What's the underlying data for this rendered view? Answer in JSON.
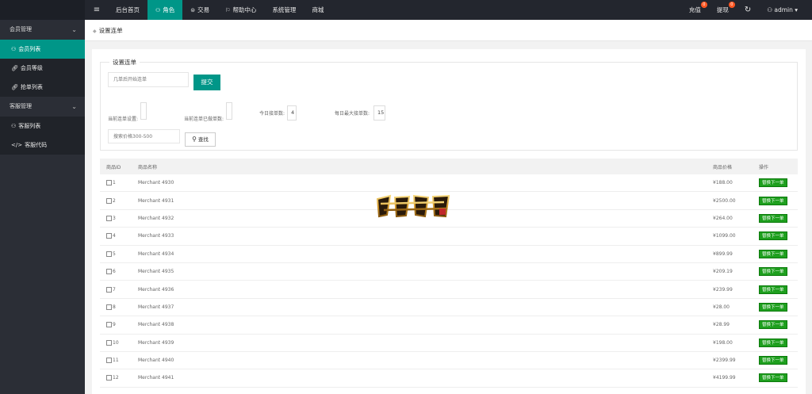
{
  "topbar": {
    "menu_toggle": "≡",
    "nav": [
      {
        "label": "后台首页",
        "icon": "",
        "active": false
      },
      {
        "label": "角色",
        "icon": "user-icon",
        "active": true
      },
      {
        "label": "交易",
        "icon": "globe-icon",
        "active": false
      },
      {
        "label": "帮助中心",
        "icon": "flag-icon",
        "active": false
      },
      {
        "label": "系统管理",
        "icon": "",
        "active": false
      },
      {
        "label": "商城",
        "icon": "",
        "active": false
      }
    ],
    "right": [
      {
        "label": "充值",
        "badge": "0"
      },
      {
        "label": "提现",
        "badge": "0"
      },
      {
        "label": "↻"
      },
      {
        "label": "admin"
      }
    ]
  },
  "sidebar": {
    "groups": [
      {
        "label": "会员管理",
        "items": [
          {
            "label": "会员列表",
            "icon": "user-icon",
            "active": true
          },
          {
            "label": "会员等级",
            "icon": "link-icon",
            "active": false
          },
          {
            "label": "抢单列表",
            "icon": "link-icon",
            "active": false
          }
        ]
      },
      {
        "label": "客服管理",
        "items": [
          {
            "label": "客服列表",
            "icon": "users-icon",
            "active": false
          },
          {
            "label": "客服代码",
            "icon": "code-icon",
            "active": false
          }
        ]
      }
    ]
  },
  "breadcrumb": "设置连单",
  "form": {
    "legend": "设置连单",
    "order_placeholder": "几单后开始连单",
    "submit_label": "提交",
    "label_current_setting": "当前连单设置:",
    "label_current_done": "当前连单已做单数:",
    "label_today": "今日接单数:",
    "today_value": "4",
    "label_max": "每日最大接单数:",
    "max_value": "15",
    "price_placeholder": "搜索价格300-500",
    "search_label": "查找"
  },
  "table": {
    "headers": {
      "id": "商品ID",
      "name": "商品名称",
      "price": "商品价格",
      "op": "操作"
    },
    "op_label": "替换下一单",
    "rows": [
      {
        "id": "1",
        "name": "Merchant 4930",
        "price": "¥188.00"
      },
      {
        "id": "2",
        "name": "Merchant 4931",
        "price": "¥2500.00"
      },
      {
        "id": "3",
        "name": "Merchant 4932",
        "price": "¥264.00"
      },
      {
        "id": "4",
        "name": "Merchant 4933",
        "price": "¥1099.00"
      },
      {
        "id": "5",
        "name": "Merchant 4934",
        "price": "¥899.99"
      },
      {
        "id": "6",
        "name": "Merchant 4935",
        "price": "¥209.19"
      },
      {
        "id": "7",
        "name": "Merchant 4936",
        "price": "¥239.99"
      },
      {
        "id": "8",
        "name": "Merchant 4937",
        "price": "¥28.00"
      },
      {
        "id": "9",
        "name": "Merchant 4938",
        "price": "¥28.99"
      },
      {
        "id": "10",
        "name": "Merchant 4939",
        "price": "¥198.00"
      },
      {
        "id": "11",
        "name": "Merchant 4940",
        "price": "¥2399.99"
      },
      {
        "id": "12",
        "name": "Merchant 4941",
        "price": "¥4199.99"
      }
    ]
  }
}
